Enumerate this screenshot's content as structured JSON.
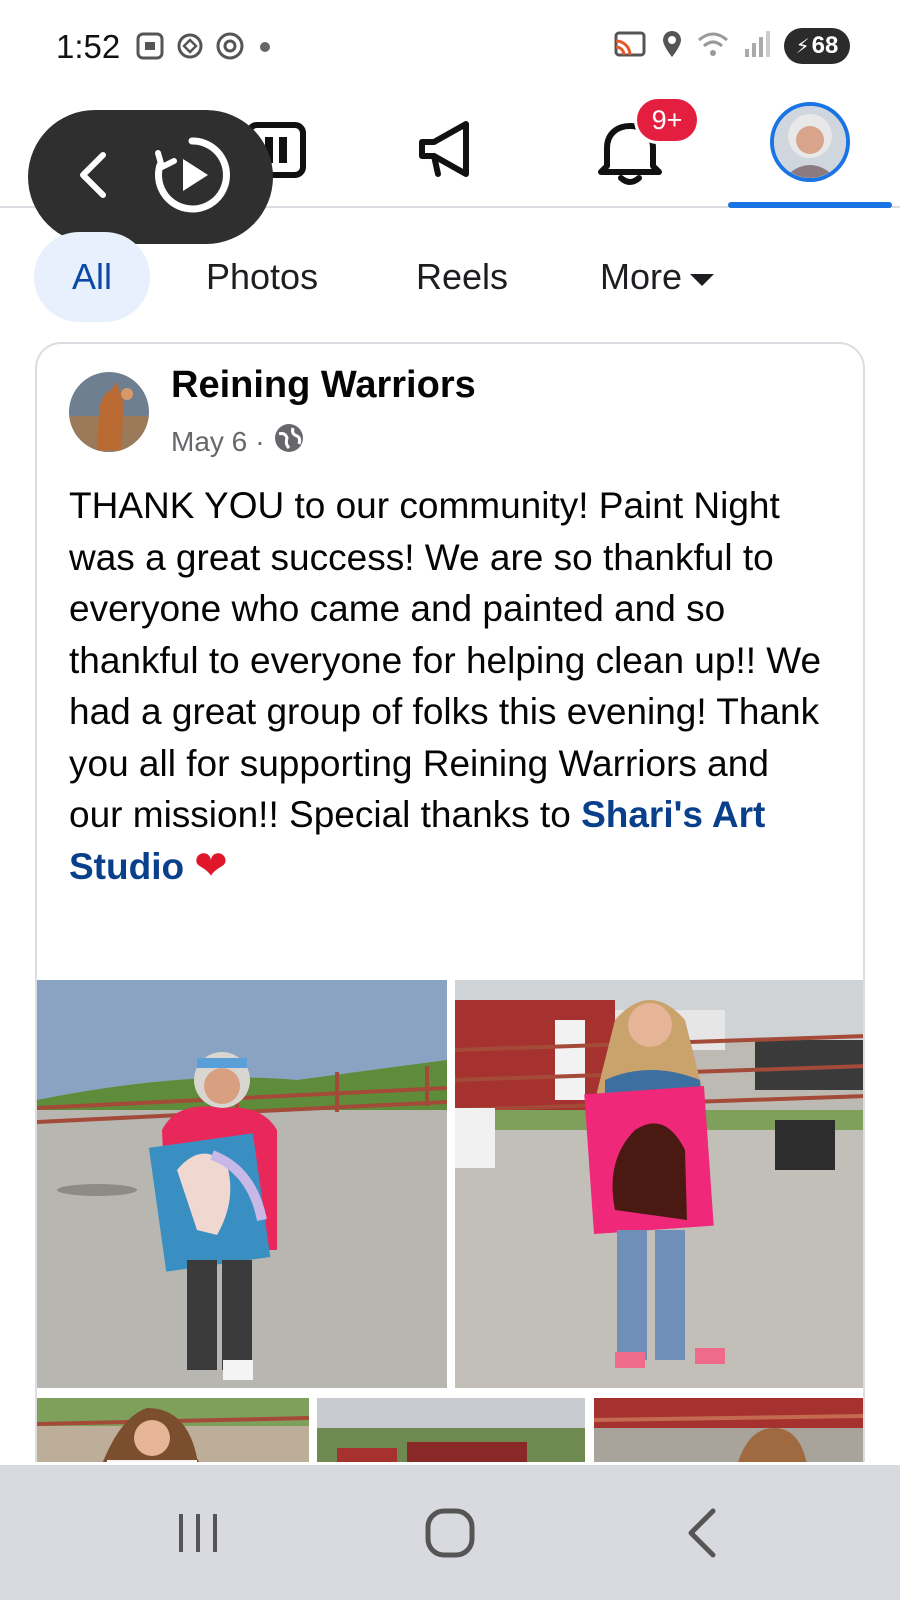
{
  "status_bar": {
    "time": "1:52",
    "battery": "68",
    "icons": [
      "screenshot-icon",
      "chatgpt-icon",
      "threads-icon",
      "dot-icon",
      "cast-icon",
      "location-icon",
      "wifi-icon",
      "signal-icon",
      "battery-icon"
    ]
  },
  "top_nav": {
    "icons": [
      "marketplace-icon",
      "megaphone-icon",
      "notifications-bell-icon",
      "profile-avatar"
    ],
    "notification_badge": "9+",
    "active_color": "#1b74e4"
  },
  "floating_controls": {
    "icons": [
      "back-chevron-icon",
      "screen-record-icon"
    ]
  },
  "filter_tabs": [
    {
      "label": "All",
      "active": true
    },
    {
      "label": "Photos"
    },
    {
      "label": "Reels"
    },
    {
      "label": "More"
    }
  ],
  "post": {
    "author": "Reining Warriors",
    "date": "May 6",
    "separator": "·",
    "privacy_icon": "globe-icon",
    "text_main": "THANK YOU to our community! Paint Night was a great success! We are so thankful to everyone who came and painted and so thankful to everyone for helping clean up!! We had a great group of folks this evening! Thank you all for supporting Reining Warriors and our mission!! Special thanks to ",
    "link_text": "Shari's Art Studio",
    "emoji": "❤",
    "link_color": "#0a3f8c"
  },
  "system_nav": {
    "icons": [
      "recent-apps-icon",
      "home-icon",
      "back-icon"
    ]
  }
}
